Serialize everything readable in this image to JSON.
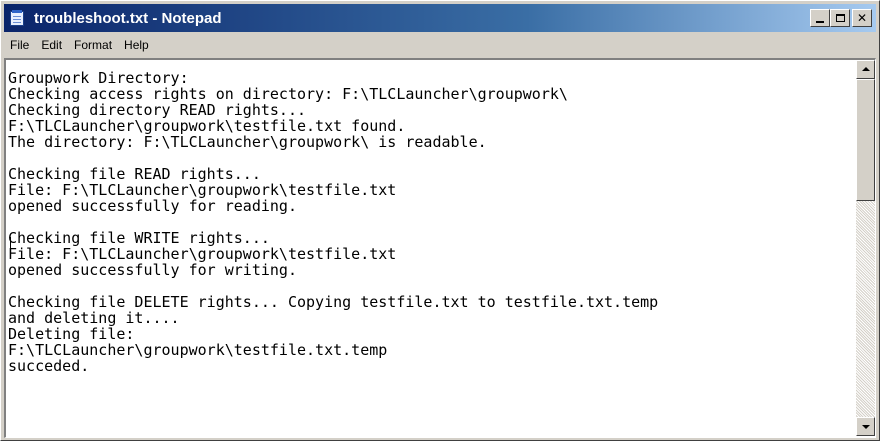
{
  "window": {
    "title": "troubleshoot.txt - Notepad"
  },
  "menu": {
    "items": [
      "File",
      "Edit",
      "Format",
      "Help"
    ]
  },
  "editor": {
    "lines": [
      "Groupwork Directory:",
      "Checking access rights on directory: F:\\TLCLauncher\\groupwork\\",
      "Checking directory READ rights...",
      "F:\\TLCLauncher\\groupwork\\testfile.txt found.",
      "The directory: F:\\TLCLauncher\\groupwork\\ is readable.",
      "",
      "Checking file READ rights...",
      "File: F:\\TLCLauncher\\groupwork\\testfile.txt",
      "opened successfully for reading.",
      "",
      "Checking file WRITE rights...",
      "File: F:\\TLCLauncher\\groupwork\\testfile.txt",
      "opened successfully for writing.",
      "",
      "Checking file DELETE rights... Copying testfile.txt to testfile.txt.temp",
      "and deleting it....",
      "Deleting file:",
      "F:\\TLCLauncher\\groupwork\\testfile.txt.temp",
      "succeded."
    ]
  },
  "icons": {
    "app": "notepad-icon",
    "minimize": "minimize-icon",
    "maximize": "maximize-icon",
    "close": "close-icon",
    "scroll_up": "arrow-up-icon",
    "scroll_down": "arrow-down-icon"
  },
  "colors": {
    "titlebar_start": "#0a246a",
    "titlebar_end": "#a6caf0",
    "chrome": "#d4d0c8"
  }
}
